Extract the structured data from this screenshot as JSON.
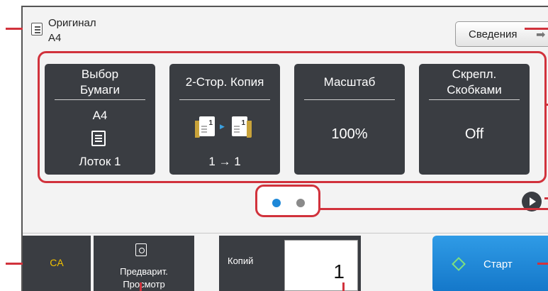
{
  "original": {
    "title": "Оригинал",
    "size": "A4"
  },
  "info_button": {
    "label": "Сведения",
    "arrow": "➡"
  },
  "tiles": [
    {
      "label_line1": "Выбор",
      "label_line2": "Бумаги",
      "size": "A4",
      "tray": "Лоток 1"
    },
    {
      "label": "2-Стор. Копия",
      "mode": "1 → 1",
      "page_number": "1"
    },
    {
      "label": "Масштаб",
      "value": "100%"
    },
    {
      "label_line1": "Скрепл.",
      "label_line2": "Скобками",
      "value": "Off"
    }
  ],
  "pager": {
    "pages": 2,
    "current": 1
  },
  "bottom": {
    "ca_label": "CA",
    "preview_line1": "Предварит.",
    "preview_line2": "Просмотр",
    "copies_label": "Копий",
    "copies_value": "1",
    "start_label": "Старт"
  },
  "colors": {
    "accent": "#d1323c",
    "tile_bg": "#3a3d42",
    "start_blue": "#1e88d8",
    "ca_yellow": "#f2c200"
  },
  "icons": {
    "original": "document-icon",
    "paper": "paper-tray-icon",
    "duplex": "duplex-pages-icon",
    "preview": "preview-icon",
    "start": "start-diamond-icon",
    "next": "next-page-icon"
  }
}
